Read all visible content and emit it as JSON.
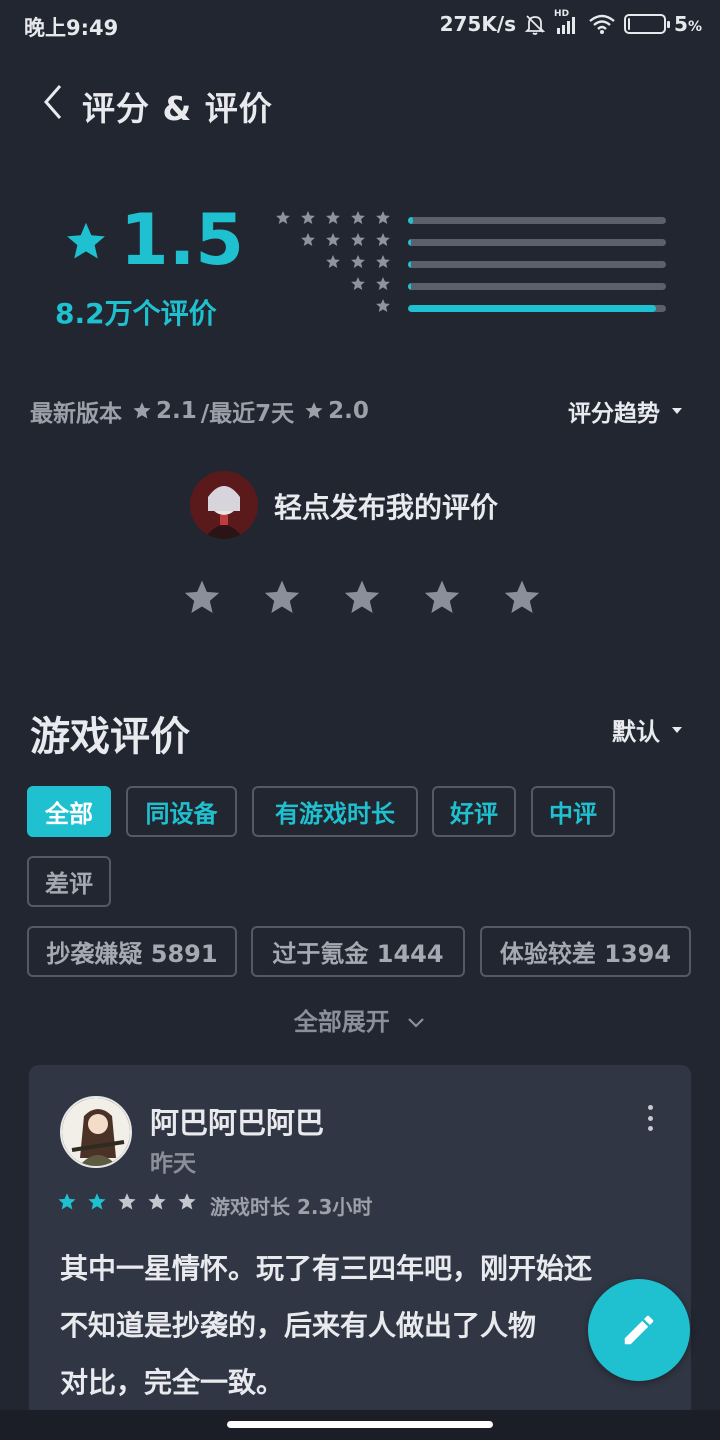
{
  "status_bar": {
    "time": "晚上9:49",
    "net_speed": "275K/s",
    "hd_label": "HD",
    "battery_percent": "5",
    "battery_unit": "%",
    "battery_level": 0.05
  },
  "header": {
    "title": "评分 & 评价",
    "back_icon": "chevron-left-icon"
  },
  "rating": {
    "score": "1.5",
    "count": "8.2万个评价",
    "distribution": [
      {
        "stars": 5,
        "fraction": 0.02
      },
      {
        "stars": 4,
        "fraction": 0.01
      },
      {
        "stars": 3,
        "fraction": 0.01
      },
      {
        "stars": 2,
        "fraction": 0.01
      },
      {
        "stars": 1,
        "fraction": 0.96
      }
    ],
    "latest_version_label": "最新版本",
    "latest_version_score": "2.1",
    "recent_label": "/最近7天",
    "recent_score": "2.0",
    "trend_label": "评分趋势"
  },
  "post": {
    "label": "轻点发布我的评价",
    "star_count": 5
  },
  "reviews": {
    "title": "游戏评价",
    "sort_label": "默认",
    "filters": [
      "全部",
      "同设备",
      "有游戏时长",
      "好评",
      "中评",
      "差评"
    ],
    "tags": [
      "抄袭嫌疑 5891",
      "过于氪金 1444",
      "体验较差 1394"
    ],
    "expand_label": "全部展开",
    "items": [
      {
        "author": "阿巴阿巴阿巴",
        "date": "昨天",
        "rating": 2,
        "playtime": "游戏时长 2.3小时",
        "text_lines": [
          "其中一星情怀。玩了有三四年吧，刚开始还",
          "不知道是抄袭的，后来有人做出了人物",
          "对比，完全一致。"
        ]
      }
    ]
  },
  "colors": {
    "accent": "#1fc1d0",
    "background": "#222630",
    "card": "#313644",
    "star_gray": "#8e939c"
  }
}
